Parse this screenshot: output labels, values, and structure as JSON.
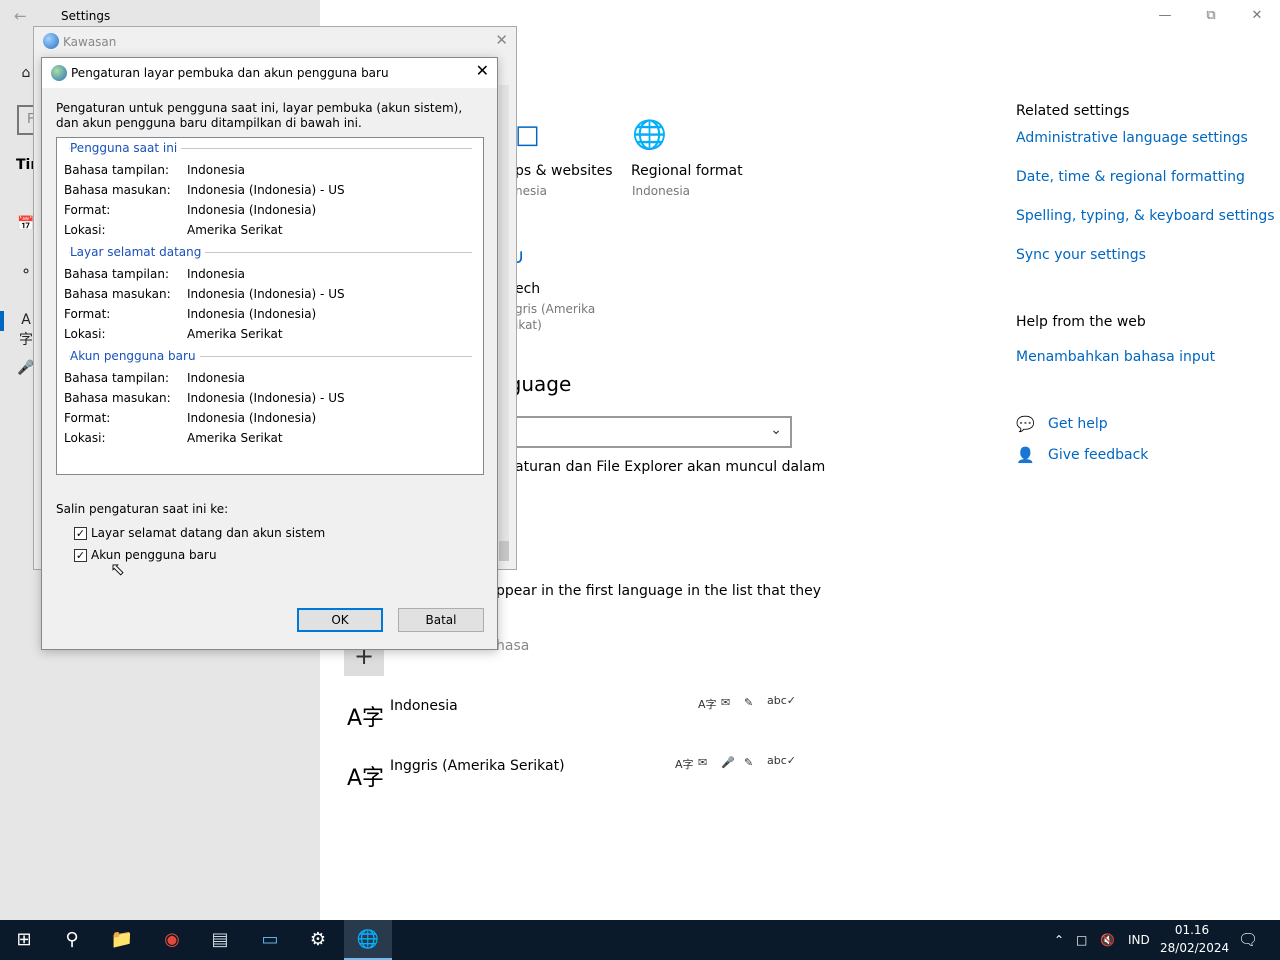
{
  "settings": {
    "title": "Settings",
    "side_stub": "Tin",
    "search_stub": "F",
    "tiles": {
      "apps_title": "ps & websites",
      "apps_sub": "nesia",
      "regional_title": "Regional format",
      "regional_sub": "Indonesia",
      "speech_title": "ech",
      "speech_sub1": "gris (Amerika",
      "speech_sub2": "ikat)"
    },
    "language_heading": "nguage",
    "dropdown_stub": "",
    "explorer_text": "aturan dan File Explorer akan muncul dalam",
    "list_title_stub": "s",
    "appear_text": "ppear in the first language in the list that they",
    "add_language_stub": "Tambahkan bahasa",
    "languages": [
      {
        "glyph": "A字",
        "name": "Indonesia"
      },
      {
        "glyph": "A字",
        "name": "Inggris (Amerika Serikat)"
      }
    ],
    "related": {
      "title": "Related settings",
      "links": [
        "Administrative language settings",
        "Date, time & regional formatting",
        "Spelling, typing, & keyboard settings",
        "Sync your settings"
      ]
    },
    "help_web": {
      "title": "Help from the web",
      "link": "Menambahkan bahasa input"
    },
    "get_help": "Get help",
    "give_feedback": "Give feedback"
  },
  "kawasan": {
    "title": "Kawasan"
  },
  "dialog": {
    "title": "Pengaturan layar pembuka dan akun pengguna baru",
    "description": "Pengaturan untuk pengguna saat ini, layar pembuka (akun sistem), dan akun pengguna baru ditampilkan di bawah ini.",
    "sections": [
      {
        "heading": "Pengguna saat ini",
        "rows": [
          {
            "label": "Bahasa tampilan:",
            "value": "Indonesia"
          },
          {
            "label": "Bahasa masukan:",
            "value": "Indonesia (Indonesia) - US"
          },
          {
            "label": "Format:",
            "value": "Indonesia (Indonesia)"
          },
          {
            "label": "Lokasi:",
            "value": "Amerika Serikat"
          }
        ]
      },
      {
        "heading": "Layar selamat datang",
        "rows": [
          {
            "label": "Bahasa tampilan:",
            "value": "Indonesia"
          },
          {
            "label": "Bahasa masukan:",
            "value": "Indonesia (Indonesia) - US"
          },
          {
            "label": "Format:",
            "value": "Indonesia (Indonesia)"
          },
          {
            "label": "Lokasi:",
            "value": "Amerika Serikat"
          }
        ]
      },
      {
        "heading": "Akun pengguna baru",
        "rows": [
          {
            "label": "Bahasa tampilan:",
            "value": "Indonesia"
          },
          {
            "label": "Bahasa masukan:",
            "value": "Indonesia (Indonesia) - US"
          },
          {
            "label": "Format:",
            "value": "Indonesia (Indonesia)"
          },
          {
            "label": "Lokasi:",
            "value": "Amerika Serikat"
          }
        ]
      }
    ],
    "copy_label": "Salin pengaturan saat ini ke:",
    "checkbox_welcome": "Layar selamat datang dan akun sistem",
    "checkbox_welcome_checked": true,
    "checkbox_new_user": "Akun pengguna baru",
    "checkbox_new_user_checked": true,
    "ok_label": "OK",
    "cancel_label": "Batal"
  },
  "taskbar": {
    "language": "IND",
    "time": "01.16",
    "date": "28/02/2024"
  }
}
